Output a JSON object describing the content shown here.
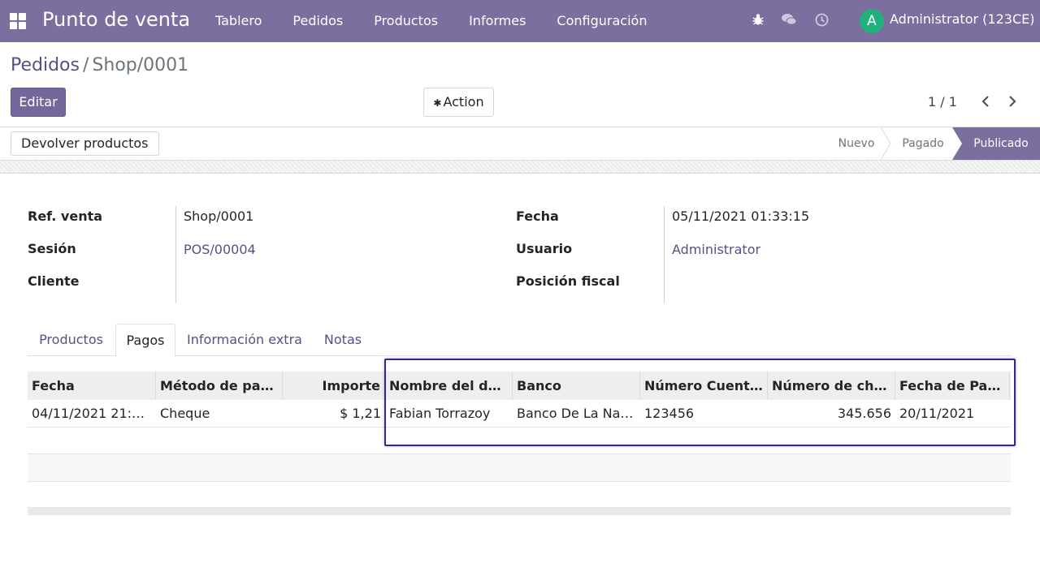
{
  "navbar": {
    "app_name": "Punto de venta",
    "menu": [
      "Tablero",
      "Pedidos",
      "Productos",
      "Informes",
      "Configuración"
    ],
    "user_initial": "A",
    "user_name": "Administrator (123CE)",
    "icons": [
      "apps-icon",
      "bug-icon",
      "chat-icon",
      "clock-icon"
    ]
  },
  "breadcrumb": {
    "parent": "Pedidos",
    "separator": "/",
    "current": "Shop/0001"
  },
  "buttons": {
    "edit": "Editar",
    "action": "Action",
    "return_products": "Devolver productos"
  },
  "pager": {
    "value": "1 / 1"
  },
  "status_stages": [
    {
      "label": "Nuevo",
      "active": false
    },
    {
      "label": "Pagado",
      "active": false
    },
    {
      "label": "Publicado",
      "active": true
    }
  ],
  "form": {
    "left": [
      {
        "label": "Ref. venta",
        "value": "Shop/0001"
      },
      {
        "label": "Sesión",
        "value": "POS/00004"
      },
      {
        "label": "Cliente",
        "value": ""
      }
    ],
    "right": [
      {
        "label": "Fecha",
        "value": "05/11/2021 01:33:15"
      },
      {
        "label": "Usuario",
        "value": "Administrator"
      },
      {
        "label": "Posición fiscal",
        "value": ""
      }
    ]
  },
  "tabs": [
    "Productos",
    "Pagos",
    "Información extra",
    "Notas"
  ],
  "active_tab": "Pagos",
  "payments_table": {
    "headers": [
      "Fecha",
      "Método de pago",
      "Importe",
      "Nombre del due…",
      "Banco",
      "Número Cuenta …",
      "Número de che…",
      "Fecha de Pago"
    ],
    "rows": [
      [
        "04/11/2021 21:…",
        "Cheque",
        "$ 1,21",
        "Fabian Torrazoy",
        "Banco De La Naci…",
        "123456",
        "345.656",
        "20/11/2021"
      ]
    ]
  },
  "colors": {
    "brand": "#7c6e9e",
    "link": "#5c4d84",
    "highlight": "#2f2a8f"
  }
}
